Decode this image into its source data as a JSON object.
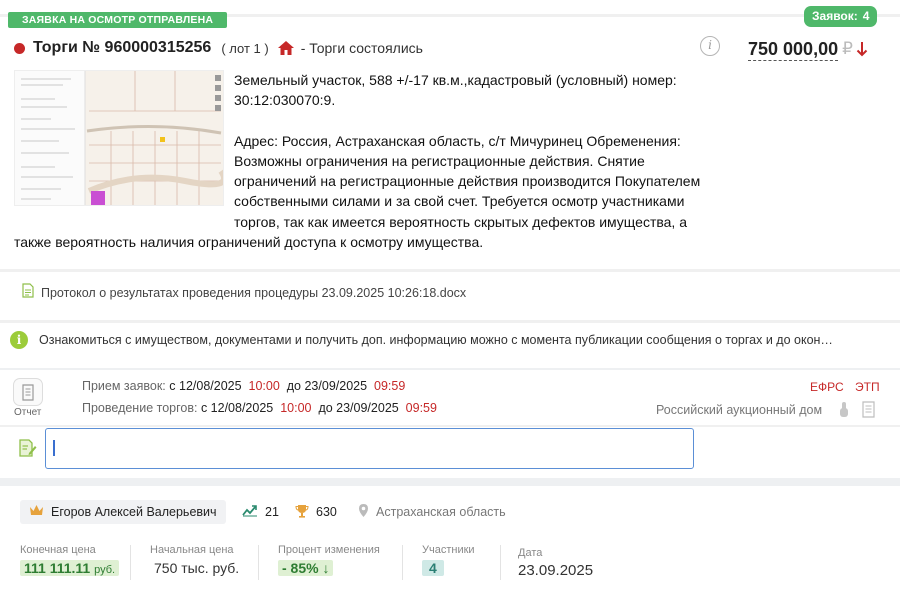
{
  "lot": {
    "tag_sent": "ЗАЯВКА НА ОСМОТР ОТПРАВЛЕНА",
    "bids_label": "Заявок:",
    "bids_count": "4",
    "title": "Торги № 960000315256",
    "lot_number": "( лот 1 )",
    "status": "- Торги состоялись",
    "status_color": "#c62828",
    "price": "750 000,00",
    "currency": "₽",
    "desc_p1": "Земельный участок, 588 +/-17 кв.м.,кадастровый (условный) номер: 30:12:030070:9.",
    "desc_p2": "Адрес: Россия, Астраханская область, с/т Мичуринец Обременения: Возможны ограничения на регистрационные действия. Снятие ограничений на регистрационные действия производится Покупателем собственными силами и за свой счет. Требуется осмотр участниками торгов, так как имеется вероятность скрытых дефектов имущества, а также вероятность наличия ограничений доступа к осмотру имущества.",
    "document": "Протокол о результатах проведения процедуры 23.09.2025 10:26:18.docx",
    "notice": "Ознакомиться с имуществом, документами и получить доп. информацию можно с момента публикации сообщения о торгах и до окон…"
  },
  "schedule": {
    "report_label": "Отчет",
    "applications_label": "Прием заявок:",
    "applications_from": "с 12/08/2025",
    "applications_from_time": "10:00",
    "applications_to": "до 23/09/2025",
    "applications_to_time": "09:59",
    "auction_label": "Проведение торгов:",
    "auction_from": "с 12/08/2025",
    "auction_from_time": "10:00",
    "auction_to": "до 23/09/2025",
    "auction_to_time": "09:59",
    "efrs": "ЕФРС",
    "etp": "ЭТП",
    "platform": "Российский аукционный дом"
  },
  "comment": {
    "value": "",
    "placeholder": ""
  },
  "result": {
    "winner": "Егоров Алексей Валерьевич",
    "stat_lots": "21",
    "stat_wins": "630",
    "region": "Астраханская область",
    "final_price_label": "Конечная цена",
    "final_price_value": "111 111.11",
    "final_price_unit": "руб.",
    "start_price_label": "Начальная цена",
    "start_price_value": "750 тыс. руб.",
    "change_label": "Процент изменения",
    "change_value": "- 85%",
    "participants_label": "Участники",
    "participants_value": "4",
    "date_label": "Дата",
    "date_value": "23.09.2025"
  },
  "colors": {
    "green": "#4fb86a",
    "red": "#c62828",
    "teal": "#2a7f74"
  }
}
